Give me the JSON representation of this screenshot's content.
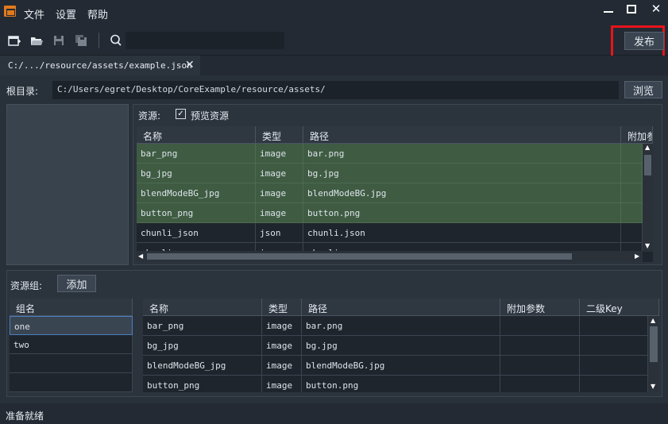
{
  "menu": {
    "file": "文件",
    "settings": "设置",
    "help": "帮助"
  },
  "window": {
    "minimize": "—",
    "maximize": "☐",
    "close": "✕"
  },
  "toolbar": {
    "icons": [
      "new-file-icon",
      "open-folder-icon",
      "save-icon",
      "save-all-icon",
      "search-icon"
    ],
    "search_value": "",
    "publish_label": "发布"
  },
  "tab": {
    "label": "C:/.../resource/assets/example.json",
    "close": "✕"
  },
  "root": {
    "label": "根目录:",
    "path": "C:/Users/egret/Desktop/CoreExample/resource/assets/",
    "browse_label": "浏览"
  },
  "resources": {
    "label": "资源:",
    "preview_checked": true,
    "preview_label": "预览资源",
    "columns": [
      "名称",
      "类型",
      "路径",
      "附加参"
    ],
    "rows": [
      {
        "name": "bar_png",
        "type": "image",
        "path": "bar.png",
        "selected": true
      },
      {
        "name": "bg_jpg",
        "type": "image",
        "path": "bg.jpg",
        "selected": true
      },
      {
        "name": "blendModeBG_jpg",
        "type": "image",
        "path": "blendModeBG.jpg",
        "selected": true
      },
      {
        "name": "button_png",
        "type": "image",
        "path": "button.png",
        "selected": true
      },
      {
        "name": "chunli_json",
        "type": "json",
        "path": "chunli.json",
        "selected": false
      },
      {
        "name": "chunli",
        "type": "image",
        "path": "chunli",
        "selected": false
      }
    ]
  },
  "groups": {
    "label": "资源组:",
    "add_label": "添加",
    "column": "组名",
    "items": [
      "one",
      "two"
    ],
    "selected_index": 0
  },
  "group_resources": {
    "columns": [
      "名称",
      "类型",
      "路径",
      "附加参数",
      "二级Key"
    ],
    "rows": [
      {
        "name": "bar_png",
        "type": "image",
        "path": "bar.png"
      },
      {
        "name": "bg_jpg",
        "type": "image",
        "path": "bg.jpg"
      },
      {
        "name": "blendModeBG_jpg",
        "type": "image",
        "path": "blendModeBG.jpg"
      },
      {
        "name": "button_png",
        "type": "image",
        "path": "button.png"
      }
    ]
  },
  "status": {
    "text": "准备就绪"
  },
  "colors": {
    "selected_row": "#3f5c43",
    "highlight_border": "#e8141b",
    "accent_logo": "#e07a1f"
  }
}
